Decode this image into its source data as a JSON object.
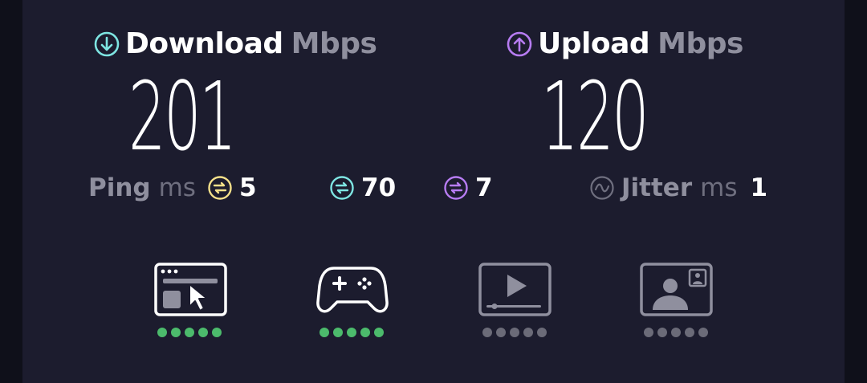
{
  "download": {
    "label": "Download",
    "unit": "Mbps",
    "value": "201",
    "icon": "arrow-down-circle-icon",
    "color": "#7ee5e2"
  },
  "upload": {
    "label": "Upload",
    "unit": "Mbps",
    "value": "120",
    "icon": "arrow-up-circle-icon",
    "color": "#b77cf2"
  },
  "ping": {
    "label": "Ping",
    "unit": "ms",
    "idle": "5",
    "download": "70",
    "upload": "7",
    "idle_color": "#f5e08a",
    "download_color": "#7ee5e2",
    "upload_color": "#b77cf2"
  },
  "jitter": {
    "label": "Jitter",
    "unit": "ms",
    "value": "1"
  },
  "use_cases": [
    {
      "icon": "web-browsing-icon",
      "rating": 5,
      "active": true
    },
    {
      "icon": "gaming-icon",
      "rating": 5,
      "active": true
    },
    {
      "icon": "video-streaming-icon",
      "rating": 0,
      "active": false
    },
    {
      "icon": "video-chat-icon",
      "rating": 0,
      "active": false
    }
  ],
  "colors": {
    "dot_on": "#4cbb6c",
    "dot_off": "#6b6b78",
    "icon_on": "#ffffff",
    "icon_off": "#8f8f9e"
  }
}
